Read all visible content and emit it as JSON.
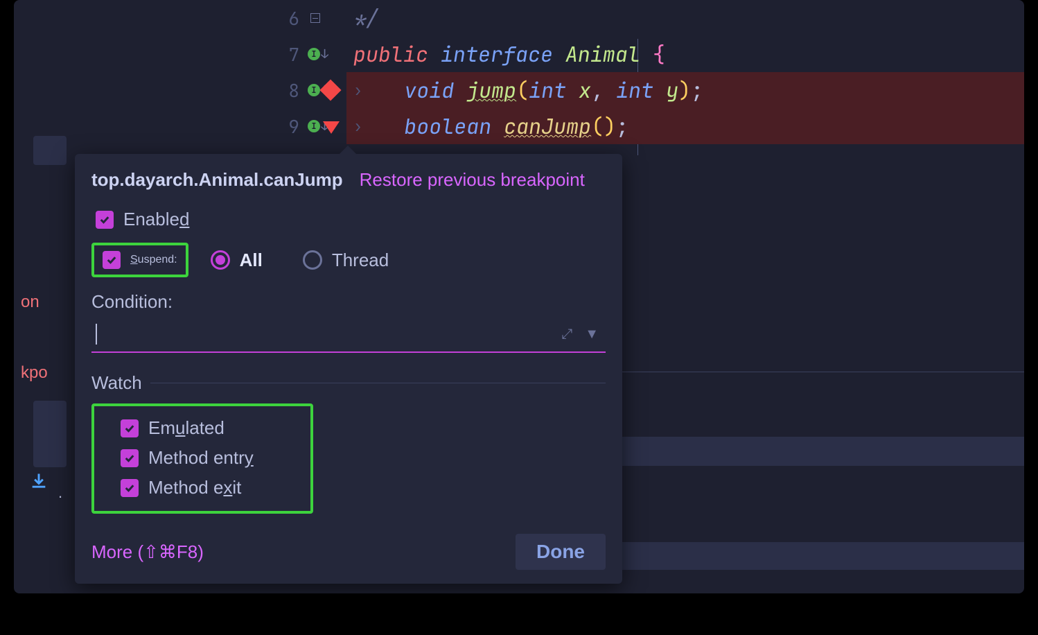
{
  "editor": {
    "lines": [
      {
        "num": "6",
        "comment": "*/"
      },
      {
        "num": "7"
      },
      {
        "num": "8"
      },
      {
        "num": "9"
      }
    ],
    "l7": {
      "kw_public": "public",
      "kw_interface": "interface",
      "ident": "Animal",
      "brace": "{"
    },
    "l8": {
      "kw_void": "void",
      "method": "jump",
      "open": "(",
      "t1": "int",
      "p1": "x",
      "comma": ",",
      "t2": "int",
      "p2": "y",
      "close": ")",
      "semi": ";"
    },
    "l9": {
      "kw_bool": "boolean",
      "method": "canJump",
      "open": "(",
      "close": ")",
      "semi": ";"
    }
  },
  "left": {
    "frag1": "on",
    "frag2": "kpo"
  },
  "popup": {
    "breakpoint_name": "top.dayarch.Animal.canJump",
    "restore_label": "Restore previous breakpoint",
    "enabled_label_pre": "Enable",
    "enabled_label_u": "d",
    "suspend_label_u": "S",
    "suspend_label_post": "uspend:",
    "radio_all": "All",
    "radio_thread": "Thread",
    "condition_label": "Condition:",
    "watch_title": "Watch",
    "emulated_pre": "Em",
    "emulated_u": "u",
    "emulated_post": "lated",
    "entry_pre": "Method entr",
    "entry_u": "y",
    "exit_pre": "Method e",
    "exit_u": "x",
    "exit_post": "it",
    "more_label": "More (⇧⌘F8)",
    "done_label": "Done"
  }
}
